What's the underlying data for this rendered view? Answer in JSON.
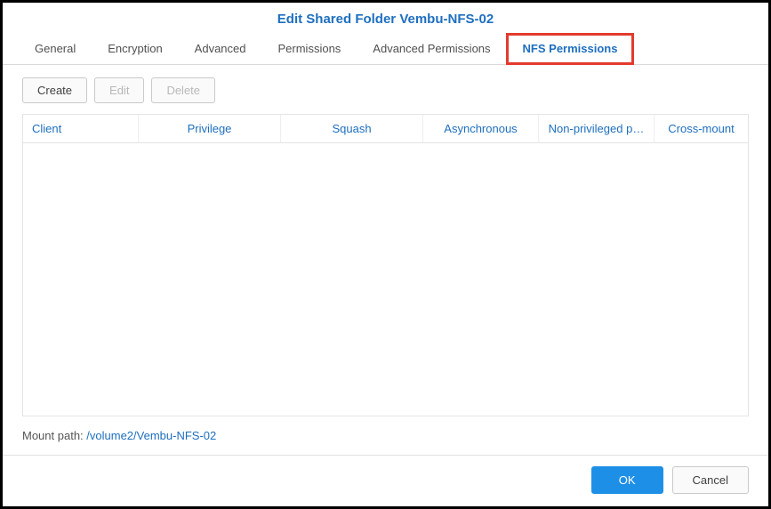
{
  "title": "Edit Shared Folder Vembu-NFS-02",
  "tabs": {
    "general": "General",
    "encryption": "Encryption",
    "advanced": "Advanced",
    "permissions": "Permissions",
    "advanced_permissions": "Advanced Permissions",
    "nfs_permissions": "NFS Permissions"
  },
  "active_tab": "nfs_permissions",
  "toolbar": {
    "create": "Create",
    "edit": "Edit",
    "delete": "Delete"
  },
  "columns": {
    "client": "Client",
    "privilege": "Privilege",
    "squash": "Squash",
    "asynchronous": "Asynchronous",
    "non_privileged": "Non-privileged p…",
    "cross_mount": "Cross-mount"
  },
  "rows": [],
  "mount_path_label": "Mount path: ",
  "mount_path_value": "/volume2/Vembu-NFS-02",
  "footer": {
    "ok": "OK",
    "cancel": "Cancel"
  }
}
